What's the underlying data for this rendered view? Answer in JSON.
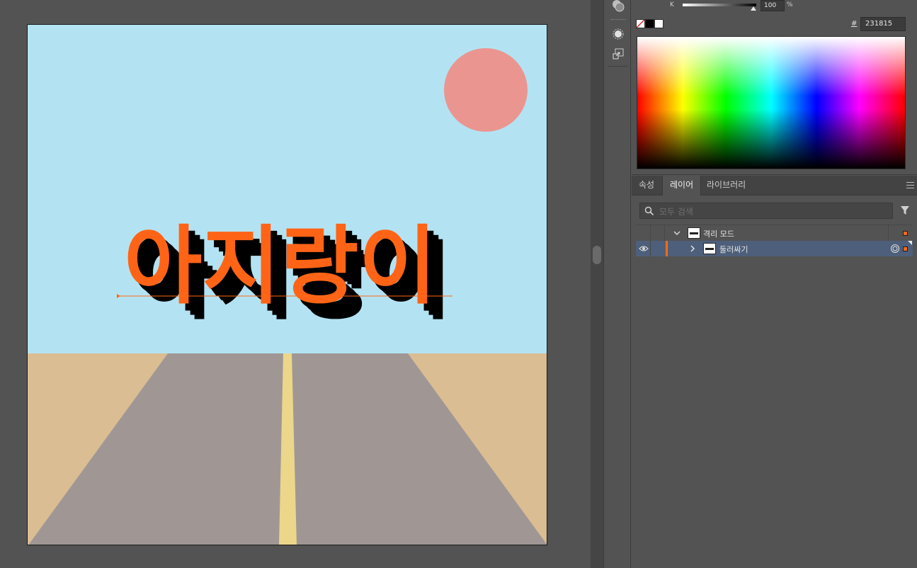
{
  "canvas": {
    "headline": "아지랑이",
    "colors": {
      "sky": "#b3e3f3",
      "sun": "#eb9591",
      "ground": "#dbbd93",
      "road": "#a09795",
      "center_line": "#ecd68a",
      "text_fill": "#ff6416",
      "text_shadow": "#000000",
      "baseline": "#ff6a14"
    }
  },
  "color_panel": {
    "k_label": "K",
    "k_value": "100",
    "k_unit": "%",
    "k_level": 1.0,
    "hash_label": "#",
    "hex_value": "231815"
  },
  "tabs": [
    {
      "label": "속성",
      "active": false
    },
    {
      "label": "레이어",
      "active": true
    },
    {
      "label": "라이브러리",
      "active": false
    }
  ],
  "layers_panel": {
    "search_placeholder": "모두 검색",
    "rows": [
      {
        "name": "격리 모드",
        "expanded": true,
        "selected": false
      },
      {
        "name": "둘러싸기",
        "expanded": false,
        "selected": true
      }
    ]
  },
  "icons": {
    "search": "search-icon",
    "filter": "filter-icon",
    "eye": "eye-icon",
    "target": "target-circle-icon",
    "menu": "panel-menu-icon"
  }
}
